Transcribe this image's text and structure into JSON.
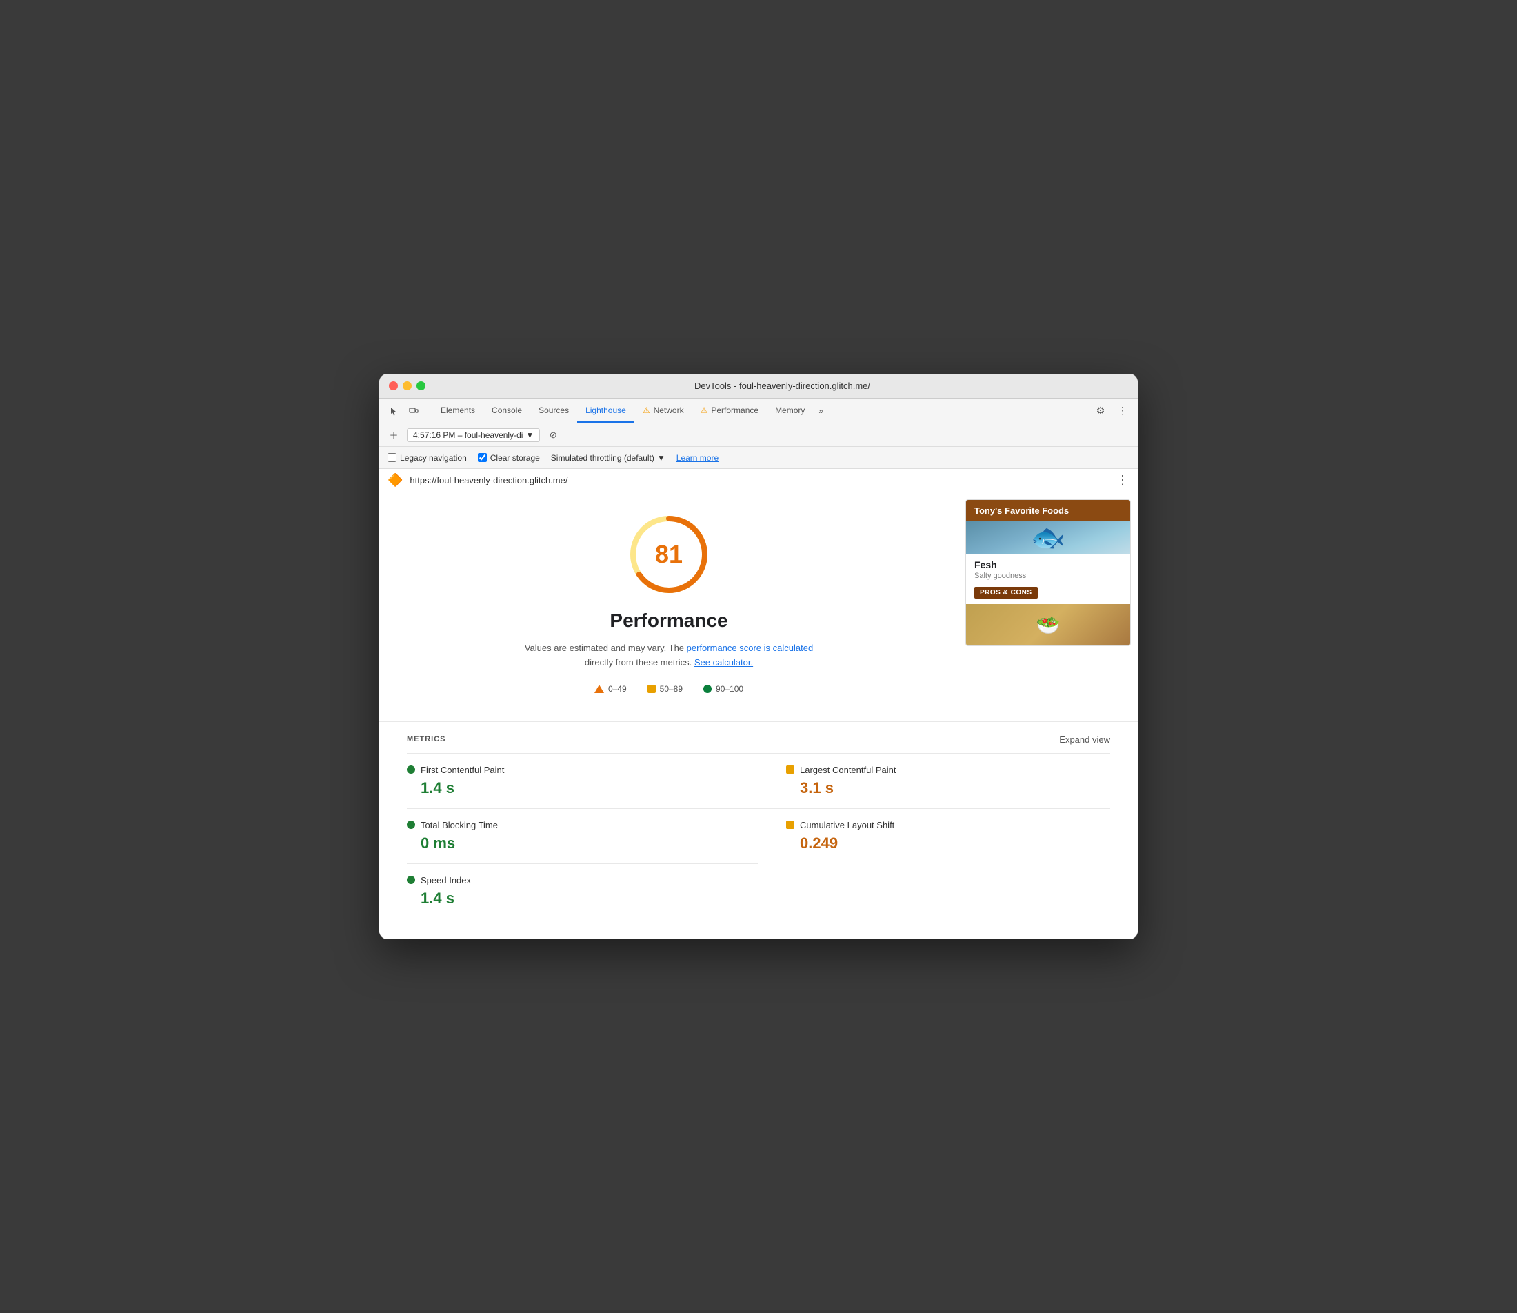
{
  "window": {
    "title": "DevTools - foul-heavenly-direction.glitch.me/"
  },
  "tabs": {
    "items": [
      {
        "label": "Elements",
        "active": false,
        "warning": false
      },
      {
        "label": "Console",
        "active": false,
        "warning": false
      },
      {
        "label": "Sources",
        "active": false,
        "warning": false
      },
      {
        "label": "Lighthouse",
        "active": true,
        "warning": false
      },
      {
        "label": "Network",
        "active": false,
        "warning": true
      },
      {
        "label": "Performance",
        "active": false,
        "warning": true
      },
      {
        "label": "Memory",
        "active": false,
        "warning": false
      }
    ],
    "more_label": "»"
  },
  "toolbar": {
    "session_label": "4:57:16 PM – foul-heavenly-di",
    "dropdown_icon": "▼",
    "reload_icon": "⊘"
  },
  "options": {
    "legacy_nav_label": "Legacy navigation",
    "legacy_nav_checked": false,
    "clear_storage_label": "Clear storage",
    "clear_storage_checked": true,
    "throttling_label": "Simulated throttling (default)",
    "throttling_dropdown": "▼",
    "learn_more_label": "Learn more"
  },
  "url_bar": {
    "icon": "🔶",
    "url": "https://foul-heavenly-direction.glitch.me/",
    "more_icon": "⋮"
  },
  "score": {
    "value": "81",
    "color": "#e8710a",
    "bg_color": "#fde68a"
  },
  "performance": {
    "title": "Performance",
    "desc_text": "Values are estimated and may vary. The ",
    "link1_text": "performance score\nis calculated",
    "desc_middle": " directly from these metrics. ",
    "link2_text": "See calculator."
  },
  "legend": {
    "items": [
      {
        "label": "0–49",
        "type": "triangle"
      },
      {
        "label": "50–89",
        "type": "square"
      },
      {
        "label": "90–100",
        "type": "circle"
      }
    ]
  },
  "food_card": {
    "header": "Tony's Favorite Foods",
    "item_name": "Fesh",
    "item_desc": "Salty goodness",
    "button_label": "PROS & CONS"
  },
  "metrics": {
    "section_title": "METRICS",
    "expand_label": "Expand view",
    "items": [
      {
        "name": "First Contentful Paint",
        "value": "1.4 s",
        "type": "green"
      },
      {
        "name": "Largest Contentful Paint",
        "value": "3.1 s",
        "type": "orange"
      },
      {
        "name": "Total Blocking Time",
        "value": "0 ms",
        "type": "green"
      },
      {
        "name": "Cumulative Layout Shift",
        "value": "0.249",
        "type": "orange"
      },
      {
        "name": "Speed Index",
        "value": "1.4 s",
        "type": "green"
      }
    ]
  }
}
